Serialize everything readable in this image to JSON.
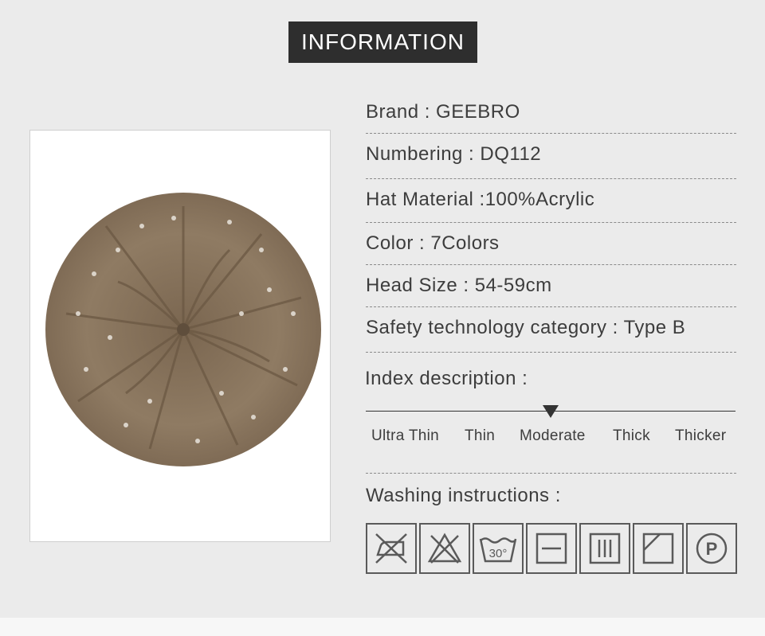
{
  "header": {
    "title": "INFORMATION"
  },
  "product_image": {
    "alt": "knit beret hat",
    "color": "#8b7760"
  },
  "specs": [
    {
      "text": "Brand : GEEBRO"
    },
    {
      "text": "Numbering : DQ112"
    },
    {
      "text": "Hat Material :100%Acrylic"
    },
    {
      "text": "Color : 7Colors"
    },
    {
      "text": "Head Size : 54-59cm"
    },
    {
      "text": "Safety technology category : Type B"
    }
  ],
  "index": {
    "title": "Index description :",
    "levels": [
      "Ultra Thin",
      "Thin",
      "Moderate",
      "Thick",
      "Thicker"
    ],
    "selected": "Moderate"
  },
  "washing": {
    "title": "Washing instructions :",
    "icons": [
      {
        "name": "no-iron-icon"
      },
      {
        "name": "no-bleach-icon"
      },
      {
        "name": "wash-30-icon",
        "label": "30°"
      },
      {
        "name": "tumble-dry-line-icon"
      },
      {
        "name": "drip-dry-icon"
      },
      {
        "name": "dry-in-shade-icon"
      },
      {
        "name": "professional-clean-p-icon",
        "label": "P"
      }
    ]
  }
}
